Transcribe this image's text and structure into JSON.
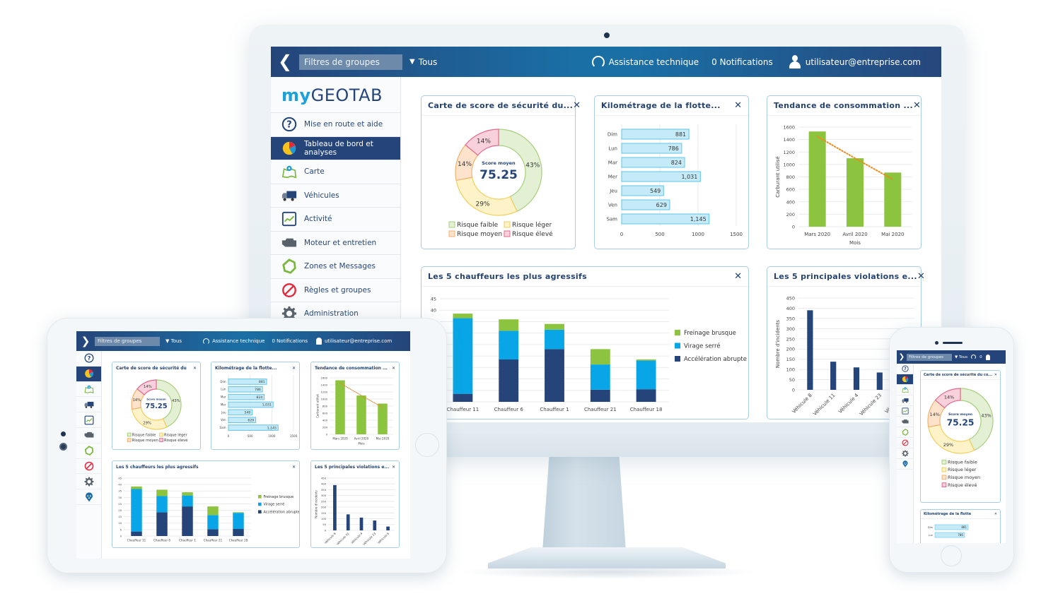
{
  "topbar": {
    "back_icon": "chevron-left-icon",
    "group_filter_label": "Filtres de groupes",
    "scope_label": "Tous",
    "support_label": "Assistance technique",
    "notifications_label": "0 Notifications",
    "user_email": "utilisateur@entreprise.com"
  },
  "brand": {
    "prefix": "my",
    "name": "GEOTAB"
  },
  "sidebar": {
    "items": [
      {
        "label": "Mise en route et aide",
        "icon": "help-icon",
        "active": false
      },
      {
        "label": "Tableau de bord et analyses",
        "icon": "dashboard-pie-icon",
        "active": true
      },
      {
        "label": "Carte",
        "icon": "map-icon",
        "active": false
      },
      {
        "label": "Véhicules",
        "icon": "truck-icon",
        "active": false
      },
      {
        "label": "Activité",
        "icon": "activity-chart-icon",
        "active": false
      },
      {
        "label": "Moteur et entretien",
        "icon": "engine-icon",
        "active": false
      },
      {
        "label": "Zones et Messages",
        "icon": "zone-icon",
        "active": false
      },
      {
        "label": "Règles et groupes",
        "icon": "rules-icon",
        "active": false
      },
      {
        "label": "Administration",
        "icon": "gear-icon",
        "active": false
      }
    ],
    "extra_compact_icon": "marketplace-pin-icon"
  },
  "colors": {
    "navy": "#25457a",
    "accent_blue": "#1ea0d8",
    "risk_low": "#e3f0d3",
    "risk_low_stroke": "#a7cf7e",
    "risk_light": "#fdf2c8",
    "risk_light_stroke": "#f2cf5b",
    "risk_medium": "#fde3cc",
    "risk_medium_stroke": "#f2b26d",
    "risk_high": "#f9d1dd",
    "risk_high_stroke": "#e26a8f",
    "bar_light_blue": "#c6ebf8",
    "bar_light_blue_stroke": "#5fc4ea",
    "fuel_green": "#8cc43f",
    "trend_orange": "#f08a1a",
    "sky_blue": "#08a6e6"
  },
  "cards": {
    "safety": {
      "title": "Carte de score de sécurité du...",
      "title_phone": "Carte de score de sécurité du co...",
      "center_label": "Score moyen",
      "center_value": "75.25",
      "close_icon": "close-icon"
    },
    "mileage": {
      "title": "Kilométrage de la flotte...",
      "title_phone": "Kilométrage de la flotte"
    },
    "fuel": {
      "title": "Tendance de consommation ..."
    },
    "drivers": {
      "title": "Les 5 chauffeurs les plus agressifs"
    },
    "violations": {
      "title": "Les 5 principales violations e..."
    }
  },
  "chart_data": [
    {
      "id": "safety",
      "type": "pie",
      "title": "Carte de score de sécurité du...",
      "donut": true,
      "center_text": "Score moyen 75.25",
      "slices": [
        {
          "name": "Risque faible",
          "value": 43,
          "label": "43%"
        },
        {
          "name": "Risque léger",
          "value": 29,
          "label": "29%"
        },
        {
          "name": "Risque moyen",
          "value": 14,
          "label": "14%"
        },
        {
          "name": "Risque élevé",
          "value": 14,
          "label": "14%"
        }
      ],
      "legend": [
        "Risque faible",
        "Risque léger",
        "Risque moyen",
        "Risque élevé"
      ],
      "legend_position": "bottom"
    },
    {
      "id": "mileage",
      "type": "bar",
      "orientation": "horizontal",
      "title": "Kilométrage de la flotte...",
      "categories": [
        "Dim",
        "Lun",
        "Mar",
        "Mer",
        "Jeu",
        "Ven",
        "Sam"
      ],
      "values": [
        881,
        786,
        824,
        1031,
        549,
        629,
        1145
      ],
      "value_labels": [
        "881",
        "786",
        "824",
        "1,031",
        "549",
        "629",
        "1,145"
      ],
      "xlim": [
        0,
        1500
      ],
      "xticks": [
        0,
        500,
        1000,
        1500
      ],
      "grid": true
    },
    {
      "id": "fuel",
      "type": "bar",
      "title": "Tendance de consommation ...",
      "categories": [
        "Mars 2020",
        "Avril 2020",
        "Mai 2020"
      ],
      "values": [
        1530,
        1100,
        870
      ],
      "trendline": [
        1450,
        1100,
        760
      ],
      "xlabel": "Mois",
      "ylabel": "Carburant utilisé",
      "ylim": [
        0,
        1600
      ],
      "yticks": [
        0,
        200,
        400,
        600,
        800,
        1000,
        1200,
        1400,
        1600
      ],
      "grid": true
    },
    {
      "id": "drivers",
      "type": "bar",
      "stacked": true,
      "title": "Les 5 chauffeurs les plus agressifs",
      "categories": [
        "Chauffeur 11",
        "Chauffeur 6",
        "Chauffeur 1",
        "Chauffeur 21",
        "Chauffeur 18"
      ],
      "series": [
        {
          "name": "Accélération abrupte",
          "values": [
            3.5,
            18.5,
            23,
            5.3,
            5.5
          ]
        },
        {
          "name": "Virage serré",
          "values": [
            33,
            12.5,
            8.5,
            11,
            12.5
          ]
        },
        {
          "name": "Freinage brusque",
          "values": [
            2,
            5,
            2.5,
            6.7,
            0.5
          ]
        }
      ],
      "legend": [
        "Freinage brusque",
        "Virage serré",
        "Accélération abrupte"
      ],
      "legend_position": "right",
      "ylim": [
        0,
        45
      ],
      "yticks": [
        0,
        5,
        10,
        15,
        20,
        25,
        30,
        35,
        40,
        45
      ],
      "grid": true
    },
    {
      "id": "violations",
      "type": "bar",
      "title": "Les 5 principales violations e...",
      "categories": [
        "Véhicule 8",
        "Véhicule 11",
        "Véhicule 4",
        "Véhicule 23",
        "Véhicule 6"
      ],
      "values": [
        390,
        138,
        110,
        85,
        33
      ],
      "ylabel": "Nombre d'incidents",
      "ylim": [
        0,
        450
      ],
      "yticks": [
        0,
        50,
        100,
        150,
        200,
        250,
        300,
        350,
        400,
        450
      ],
      "grid": true
    }
  ]
}
